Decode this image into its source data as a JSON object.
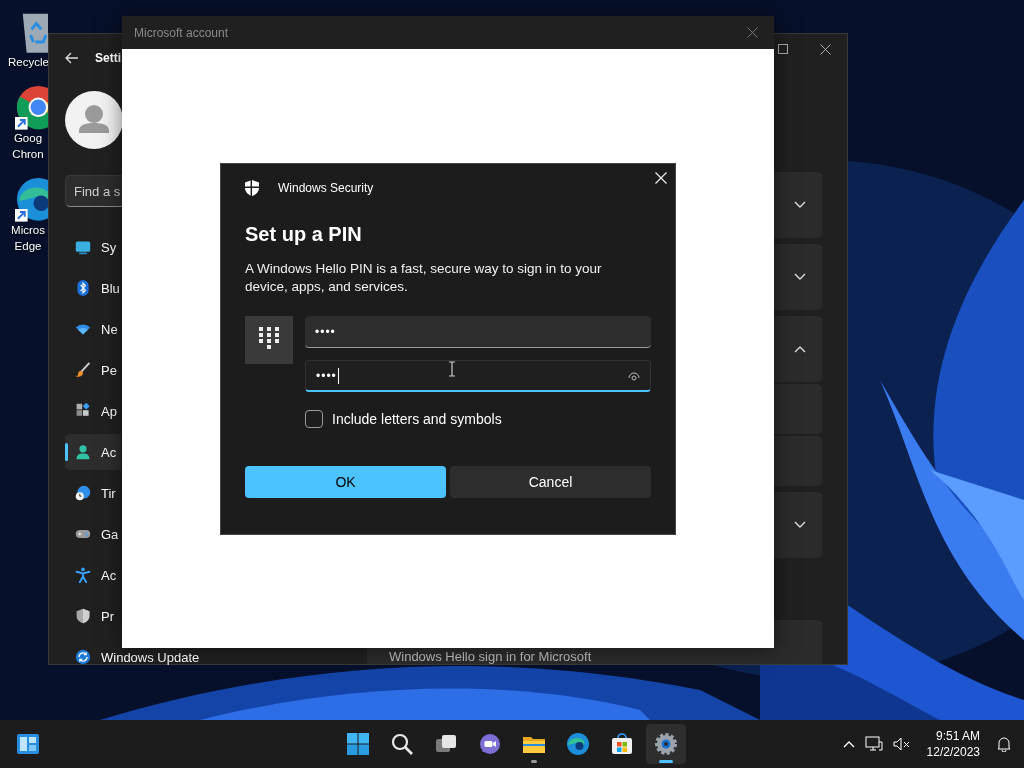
{
  "desktop_icons": [
    {
      "kind": "recycle-bin",
      "label": "Recycle"
    },
    {
      "kind": "chrome",
      "label": "Goog Chron"
    },
    {
      "kind": "edge",
      "label": "Micros Edge"
    }
  ],
  "settings_window": {
    "title": "Setti",
    "search": {
      "placeholder": "Find a s"
    },
    "nav_items": [
      {
        "kind": "system",
        "label": "Sy",
        "selected": false
      },
      {
        "kind": "bluetooth",
        "label": "Blu",
        "selected": false
      },
      {
        "kind": "network",
        "label": "Ne",
        "selected": false
      },
      {
        "kind": "personalization",
        "label": "Pe",
        "selected": false
      },
      {
        "kind": "apps",
        "label": "Ap",
        "selected": false
      },
      {
        "kind": "accounts",
        "label": "Ac",
        "selected": true
      },
      {
        "kind": "time",
        "label": "Tir",
        "selected": false
      },
      {
        "kind": "gaming",
        "label": "Ga",
        "selected": false
      },
      {
        "kind": "accessibility",
        "label": "Ac",
        "selected": false
      },
      {
        "kind": "privacy",
        "label": "Pr",
        "selected": false
      },
      {
        "kind": "update",
        "label": "Windows Update",
        "selected": false
      }
    ],
    "cards": [
      {
        "expanded": false
      },
      {
        "expanded": false
      },
      {
        "expanded": true
      },
      {
        "expanded": false
      }
    ],
    "footer_text": "Windows Hello sign in for Microsoft"
  },
  "account_window": {
    "title": "Microsoft account"
  },
  "dialog": {
    "app_name": "Windows Security",
    "title": "Set up a PIN",
    "description": "A Windows Hello PIN is a fast, secure way to sign in to your device, apps, and services.",
    "pin_fields": [
      {
        "value": "••••",
        "focused": false
      },
      {
        "value": "••••",
        "focused": true
      }
    ],
    "checkbox": {
      "label": "Include letters and symbols",
      "checked": false
    },
    "buttons": [
      {
        "label": "OK",
        "primary": true
      },
      {
        "label": "Cancel",
        "primary": false
      }
    ]
  },
  "taskbar": {
    "apps": [
      {
        "kind": "start",
        "open": false,
        "active": false
      },
      {
        "kind": "search",
        "open": false,
        "active": false
      },
      {
        "kind": "task-view",
        "open": false,
        "active": false
      },
      {
        "kind": "chat",
        "open": false,
        "active": false
      },
      {
        "kind": "explorer",
        "open": true,
        "active": false
      },
      {
        "kind": "edge",
        "open": false,
        "active": false
      },
      {
        "kind": "store",
        "open": false,
        "active": false
      },
      {
        "kind": "settings",
        "open": true,
        "active": true
      }
    ],
    "clock": {
      "time": "9:51 AM",
      "date": "12/2/2023"
    }
  }
}
